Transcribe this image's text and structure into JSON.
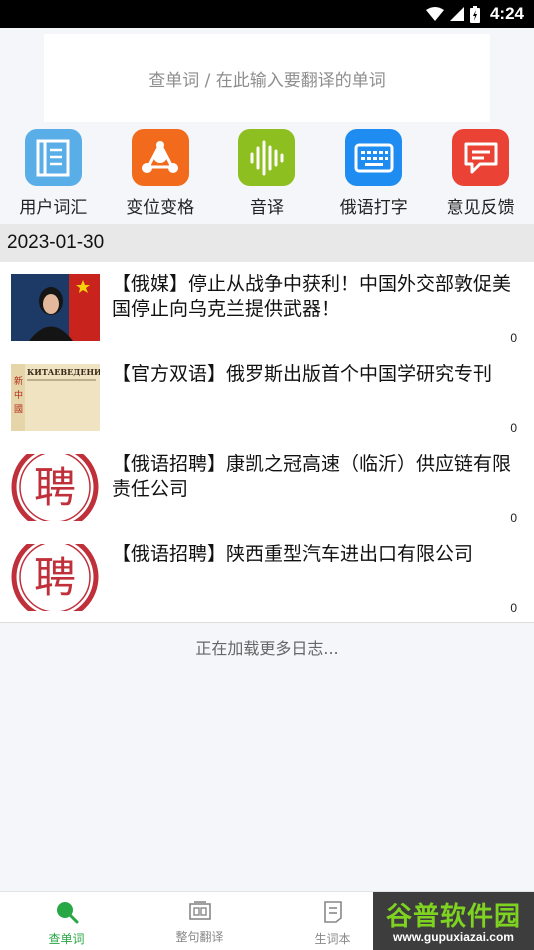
{
  "status_bar": {
    "time": "4:24"
  },
  "search": {
    "placeholder": "查单词 / 在此输入要翻译的单词"
  },
  "quick_actions": [
    {
      "label": "用户词汇",
      "icon": "notebook-icon",
      "color": "#5aaee8"
    },
    {
      "label": "变位变格",
      "icon": "share-nodes-icon",
      "color": "#f26b1d"
    },
    {
      "label": "音译",
      "icon": "sound-wave-icon",
      "color": "#8cbf1f"
    },
    {
      "label": "俄语打字",
      "icon": "keyboard-icon",
      "color": "#1e8cf0"
    },
    {
      "label": "意见反馈",
      "icon": "feedback-icon",
      "color": "#ea4335"
    }
  ],
  "date_header": "2023-01-30",
  "news": [
    {
      "title": "【俄媒】停止从战争中获利！中国外交部敦促美国停止向乌克兰提供武器！",
      "count": "0"
    },
    {
      "title": "【官方双语】俄罗斯出版首个中国学研究专刊",
      "count": "0",
      "thumb_text": "КИТАЕВЕДЕНИЕ"
    },
    {
      "title": "【俄语招聘】康凯之冠高速（临沂）供应链有限责任公司",
      "count": "0",
      "thumb_text": "聘"
    },
    {
      "title": "【俄语招聘】陕西重型汽车进出口有限公司",
      "count": "0",
      "thumb_text": "聘"
    }
  ],
  "loading_text": "正在加载更多日志...",
  "tabs": [
    {
      "label": "查单词",
      "icon": "search-icon",
      "active": true
    },
    {
      "label": "整句翻译",
      "icon": "translate-icon",
      "active": false
    },
    {
      "label": "生词本",
      "icon": "wordbook-icon",
      "active": false
    }
  ],
  "watermark": {
    "main": "谷普软件园",
    "url": "www.gupuxiazai.com"
  },
  "colors": {
    "active_tab": "#28a745",
    "date_bar": "#e8e8e8"
  }
}
